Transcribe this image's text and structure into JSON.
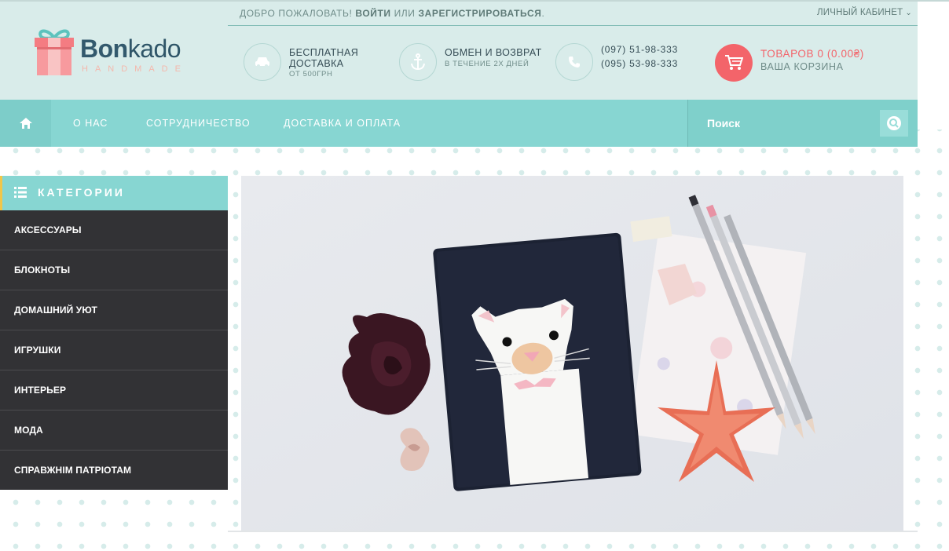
{
  "header": {
    "welcome_prefix": "Добро пожаловать!",
    "login_label": "Войти",
    "or_label": "или",
    "register_label": "Зарегистрироваться",
    "welcome_suffix": ".",
    "account_label": "Личный кабинет"
  },
  "logo": {
    "word_bon": "Bon",
    "word_kado": "kado",
    "subtitle": "Handmade"
  },
  "features": [
    {
      "title_line1": "Бесплатная",
      "title_line2": "доставка",
      "subtitle": "от 500грн",
      "icon": "car-icon"
    },
    {
      "title_line1": "Обмен и возврат",
      "subtitle": "в течение 2х дней",
      "icon": "anchor-icon"
    },
    {
      "phone1": "(097) 51-98-333",
      "phone2": "(095) 53-98-333",
      "icon": "phone-icon"
    }
  ],
  "cart": {
    "items_label": "Товаров 0 (0.00₴)",
    "subtitle": "Ваша корзина",
    "accent": "#f3646a"
  },
  "nav": {
    "items": [
      "О нас",
      "Сотрудничество",
      "Доставка и оплата"
    ],
    "search_placeholder": "Поиск",
    "color": "#87d6d2"
  },
  "categories": {
    "title": "Категории",
    "items": [
      "Аксессуары",
      "Блокноты",
      "Домашний уют",
      "Игрушки",
      "Интерьер",
      "Мода",
      "Справжнім патріотам"
    ]
  }
}
